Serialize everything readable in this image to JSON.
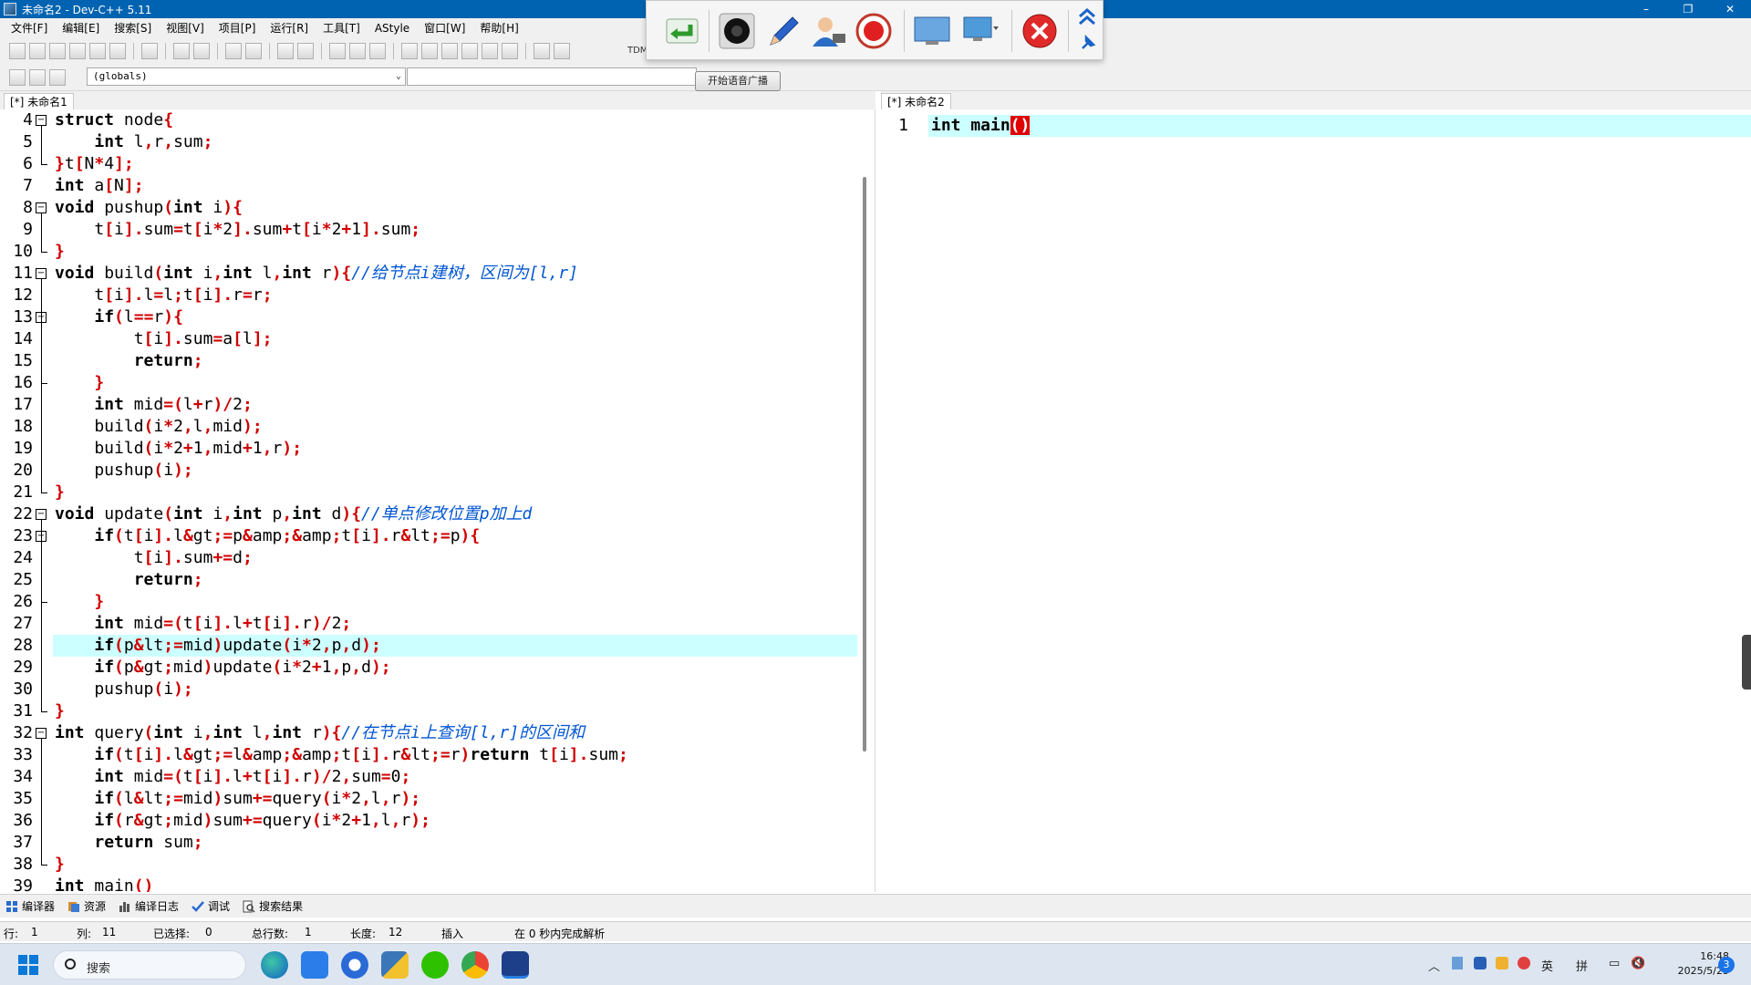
{
  "window": {
    "title": "未命名2 - Dev-C++ 5.11",
    "controls": [
      "–",
      "❐",
      "✕"
    ]
  },
  "menu": [
    "文件[F]",
    "编辑[E]",
    "搜索[S]",
    "视图[V]",
    "项目[P]",
    "运行[R]",
    "工具[T]",
    "AStyle",
    "窗口[W]",
    "帮助[H]"
  ],
  "toolbar": {
    "scope_combo": "(globals)",
    "broadcast_button": "开始语音广播",
    "tdm_label": "TDM"
  },
  "tabs": {
    "left": "[*] 未命名1",
    "right": "[*] 未命名2"
  },
  "left_editor": {
    "lines": [
      {
        "n": "4",
        "code": "struct node{"
      },
      {
        "n": "5",
        "code": "    int l,r,sum;"
      },
      {
        "n": "6",
        "code": "}t[N*4];"
      },
      {
        "n": "7",
        "code": "int a[N];"
      },
      {
        "n": "8",
        "code": "void pushup(int i){"
      },
      {
        "n": "9",
        "code": "    t[i].sum=t[i*2].sum+t[i*2+1].sum;"
      },
      {
        "n": "10",
        "code": "}"
      },
      {
        "n": "11",
        "code": "void build(int i,int l,int r){//给节点i建树，区间为[l,r]"
      },
      {
        "n": "12",
        "code": "    t[i].l=l;t[i].r=r;"
      },
      {
        "n": "13",
        "code": "    if(l==r){"
      },
      {
        "n": "14",
        "code": "        t[i].sum=a[l];"
      },
      {
        "n": "15",
        "code": "        return;"
      },
      {
        "n": "16",
        "code": "    }"
      },
      {
        "n": "17",
        "code": "    int mid=(l+r)/2;"
      },
      {
        "n": "18",
        "code": "    build(i*2,l,mid);"
      },
      {
        "n": "19",
        "code": "    build(i*2+1,mid+1,r);"
      },
      {
        "n": "20",
        "code": "    pushup(i);"
      },
      {
        "n": "21",
        "code": "}"
      },
      {
        "n": "22",
        "code": "void update(int i,int p,int d){//单点修改位置p加上d"
      },
      {
        "n": "23",
        "code": "    if(t[i].l>=p&&t[i].r<=p){"
      },
      {
        "n": "24",
        "code": "        t[i].sum+=d;"
      },
      {
        "n": "25",
        "code": "        return;"
      },
      {
        "n": "26",
        "code": "    }"
      },
      {
        "n": "27",
        "code": "    int mid=(t[i].l+t[i].r)/2;"
      },
      {
        "n": "28",
        "code": "    if(p<=mid)update(i*2,p,d);"
      },
      {
        "n": "29",
        "code": "    if(p>mid)update(i*2+1,p,d);"
      },
      {
        "n": "30",
        "code": "    pushup(i);"
      },
      {
        "n": "31",
        "code": "}"
      },
      {
        "n": "32",
        "code": "int query(int i,int l,int r){//在节点i上查询[l,r]的区间和"
      },
      {
        "n": "33",
        "code": "    if(t[i].l>=l&&t[i].r<=r)return t[i].sum;"
      },
      {
        "n": "34",
        "code": "    int mid=(t[i].l+t[i].r)/2,sum=0;"
      },
      {
        "n": "35",
        "code": "    if(l<=mid)sum+=query(i*2,l,r);"
      },
      {
        "n": "36",
        "code": "    if(r>mid)sum+=query(i*2+1,l,r);"
      },
      {
        "n": "37",
        "code": "    return sum;"
      },
      {
        "n": "38",
        "code": "}"
      },
      {
        "n": "39",
        "code": "int main()"
      }
    ]
  },
  "right_editor": {
    "line_number": "1",
    "code_before": "int main",
    "code_paren": "()"
  },
  "bottom_tabs": [
    "编译器",
    "资源",
    "编译日志",
    "调试",
    "搜索结果"
  ],
  "status": {
    "row_label": "行:",
    "row_value": "1",
    "col_label": "列:",
    "col_value": "11",
    "sel_label": "已选择:",
    "sel_value": "0",
    "total_label": "总行数:",
    "total_value": "1",
    "len_label": "长度:",
    "len_value": "12",
    "mode": "插入",
    "parse": "在 0 秒内完成解析"
  },
  "taskbar": {
    "search_placeholder": "搜索",
    "ime_lang": "英",
    "ime_mode": "拼",
    "time": "16:48",
    "date": "2025/5/25",
    "notifications": "3"
  }
}
